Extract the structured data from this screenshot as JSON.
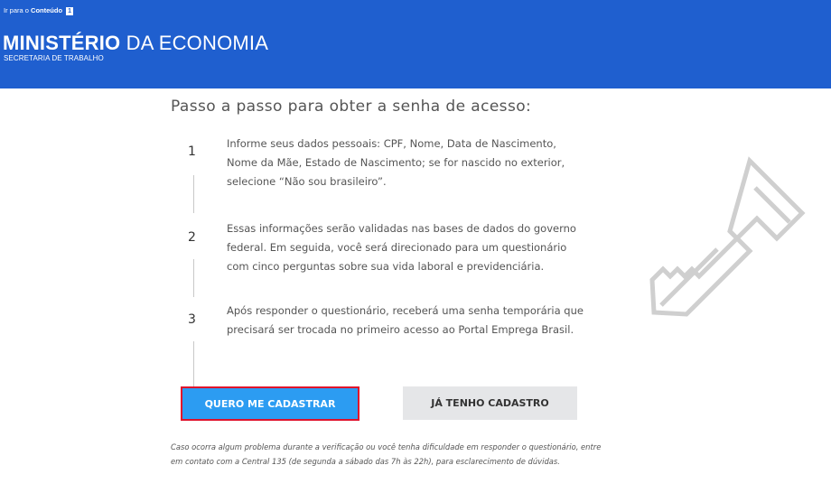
{
  "header": {
    "skip_prefix": "Ir para o",
    "skip_link": "Conteúdo",
    "skip_key": "1",
    "ministry_bold": "MINISTÉRIO",
    "ministry_rest": "DA ECONOMIA",
    "secretaria": "SECRETARIA DE TRABALHO",
    "bg_color": "#1f5fcf"
  },
  "main": {
    "title": "Passo a passo para obter a senha de acesso:",
    "steps": [
      {
        "number": "1",
        "text": "Informe seus dados pessoais: CPF, Nome, Data de Nascimento, Nome da Mãe, Estado de Nascimento; se for nascido no exterior, selecione “Não sou brasileiro”."
      },
      {
        "number": "2",
        "text": "Essas informações serão validadas nas bases de dados do governo federal. Em seguida, você será direcionado para um questionário com cinco perguntas sobre sua vida laboral e previdenciária."
      },
      {
        "number": "3",
        "text": "Após responder o questionário, receberá uma senha temporária que precisará ser trocada no primeiro acesso ao Portal Emprega Brasil."
      }
    ],
    "primary_button": "QUERO ME CADASTRAR",
    "secondary_button": "JÁ TENHO CADASTRO",
    "footer_note": "Caso ocorra algum problema durante a verificação ou você tenha dificuldade em responder o questionário, entre em contato com a Central 135 (de segunda a sábado das 7h às 22h), para esclarecimento de dúvidas.",
    "key_icon": "key-icon",
    "primary_color": "#2c9cf2",
    "highlight_color": "#e0112b"
  }
}
